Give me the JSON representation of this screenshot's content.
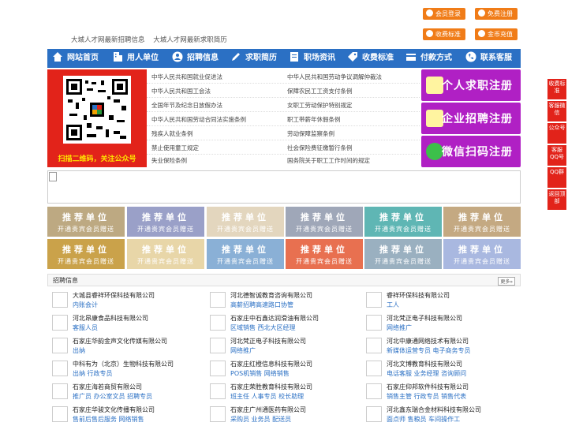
{
  "header": {
    "slogans": [
      "大城人才网最新招聘信息",
      "大城人才网最新求职简历"
    ],
    "buttons": {
      "login": "会员登录",
      "register": "免费注册",
      "fee": "收费标准",
      "recharge": "金币充值"
    }
  },
  "nav": [
    {
      "label": "网站首页",
      "icon": "home-icon"
    },
    {
      "label": "用人单位",
      "icon": "building-icon"
    },
    {
      "label": "招聘信息",
      "icon": "people-icon"
    },
    {
      "label": "求职简历",
      "icon": "pen-icon"
    },
    {
      "label": "职场资讯",
      "icon": "document-icon"
    },
    {
      "label": "收费标准",
      "icon": "tag-icon"
    },
    {
      "label": "付款方式",
      "icon": "card-icon"
    },
    {
      "label": "联系客服",
      "icon": "phone-icon"
    }
  ],
  "qr": {
    "caption": "扫描二维码，关注公众号"
  },
  "laws": [
    [
      "中华人民共和国就业促进法",
      "中华人民共和国劳动争议调解仲裁法"
    ],
    [
      "中华人民共和国工会法",
      "保障农民工工资支付条例"
    ],
    [
      "全国年节及纪念日放假办法",
      "女职工劳动保护特别规定"
    ],
    [
      "中华人民共和国劳动合同法实施条例",
      "职工带薪年休假条例"
    ],
    [
      "残疾人就业条例",
      "劳动保障监察条例"
    ],
    [
      "禁止使用童工规定",
      "社会保险费征缴暂行条例"
    ],
    [
      "失业保险条例",
      "国务院关于职工工作时间的规定"
    ]
  ],
  "register": {
    "person": "个人求职注册",
    "company": "企业招聘注册",
    "wechat": "微信扫码注册"
  },
  "promo": {
    "line1": "推荐单位",
    "line2": "开通贵宾会员赠送",
    "colors": [
      "#bda982",
      "#9aa0c8",
      "#e3d6be",
      "#9fa7b8",
      "#5fb6b4",
      "#c4a982",
      "#caa24a",
      "#e8d6a8",
      "#8ab0d6",
      "#e87050",
      "#9ab0c0",
      "#a9b8e0"
    ]
  },
  "jobs": {
    "title": "招聘信息",
    "more": "更多»",
    "items": [
      {
        "company": "大城县睿祥环保科技有限公司",
        "positions": "内账会计"
      },
      {
        "company": "河北德智诚教育咨询有限公司",
        "positions": "高薪招聘高速路口协管"
      },
      {
        "company": "睿祥环保科技有限公司",
        "positions": "工人"
      },
      {
        "company": "河北昂康食品科技有限公司",
        "positions": "客服人员"
      },
      {
        "company": "石家庄中石鑫达润滑油有限公司",
        "positions": "区域销售 西北大区经理"
      },
      {
        "company": "河北梵正电子科技有限公司",
        "positions": "网络推广"
      },
      {
        "company": "石家庄华韵金声文化传媒有限公司",
        "positions": "出纳"
      },
      {
        "company": "河北梵正电子科技有限公司",
        "positions": "网络推广"
      },
      {
        "company": "河北中康通网络技术有限公司",
        "positions": "新媒体运营专员 电子商务专员"
      },
      {
        "company": "中科有为（北京）生物科技有限公司",
        "positions": "出纳 行政专员"
      },
      {
        "company": "石家庄红橙信息科技有限公司",
        "positions": "POS机销售 网络销售"
      },
      {
        "company": "河北文博教育科技有限公司",
        "positions": "电话客服 业务经理 咨询顾问"
      },
      {
        "company": "石家庄海若商贸有限公司",
        "positions": "推广员 办公室文员 招聘专员"
      },
      {
        "company": "石家庄荣胜教育科技有限公司",
        "positions": "班主任 人事专员 校长助理"
      },
      {
        "company": "石家庄仰邦软件科技有限公司",
        "positions": "销售主管 行政专员 销售代表"
      },
      {
        "company": "石家庄华骏文化传播有限公司",
        "positions": "售前后售后服务 网络销售"
      },
      {
        "company": "石家庄广州通医药有限公司",
        "positions": "采购员 业务员 配送员"
      },
      {
        "company": "河北鑫东瑞合金材料科技有限公司",
        "positions": "面点师 售粮员 车间操作工"
      }
    ]
  },
  "float": [
    "收费标准",
    "客服微信",
    "公众号",
    "客服QQ号",
    "QQ群",
    "返回顶部"
  ]
}
